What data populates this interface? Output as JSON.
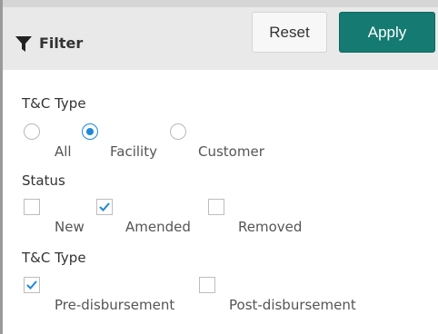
{
  "header": {
    "title": "Filter",
    "reset_label": "Reset",
    "apply_label": "Apply"
  },
  "tc_type": {
    "label": "T&C Type",
    "options": [
      {
        "label": "All",
        "selected": false
      },
      {
        "label": "Facility",
        "selected": true
      },
      {
        "label": "Customer",
        "selected": false
      }
    ]
  },
  "status": {
    "label": "Status",
    "options": [
      {
        "label": "New",
        "checked": false
      },
      {
        "label": "Amended",
        "checked": true
      },
      {
        "label": "Removed",
        "checked": false
      }
    ]
  },
  "tc_type2": {
    "label": "T&C Type",
    "options": [
      {
        "label": "Pre-disbursement",
        "checked": true
      },
      {
        "label": "Post-disbursement",
        "checked": false
      }
    ]
  },
  "colors": {
    "accent": "#1e88d8",
    "apply": "#157a72"
  }
}
